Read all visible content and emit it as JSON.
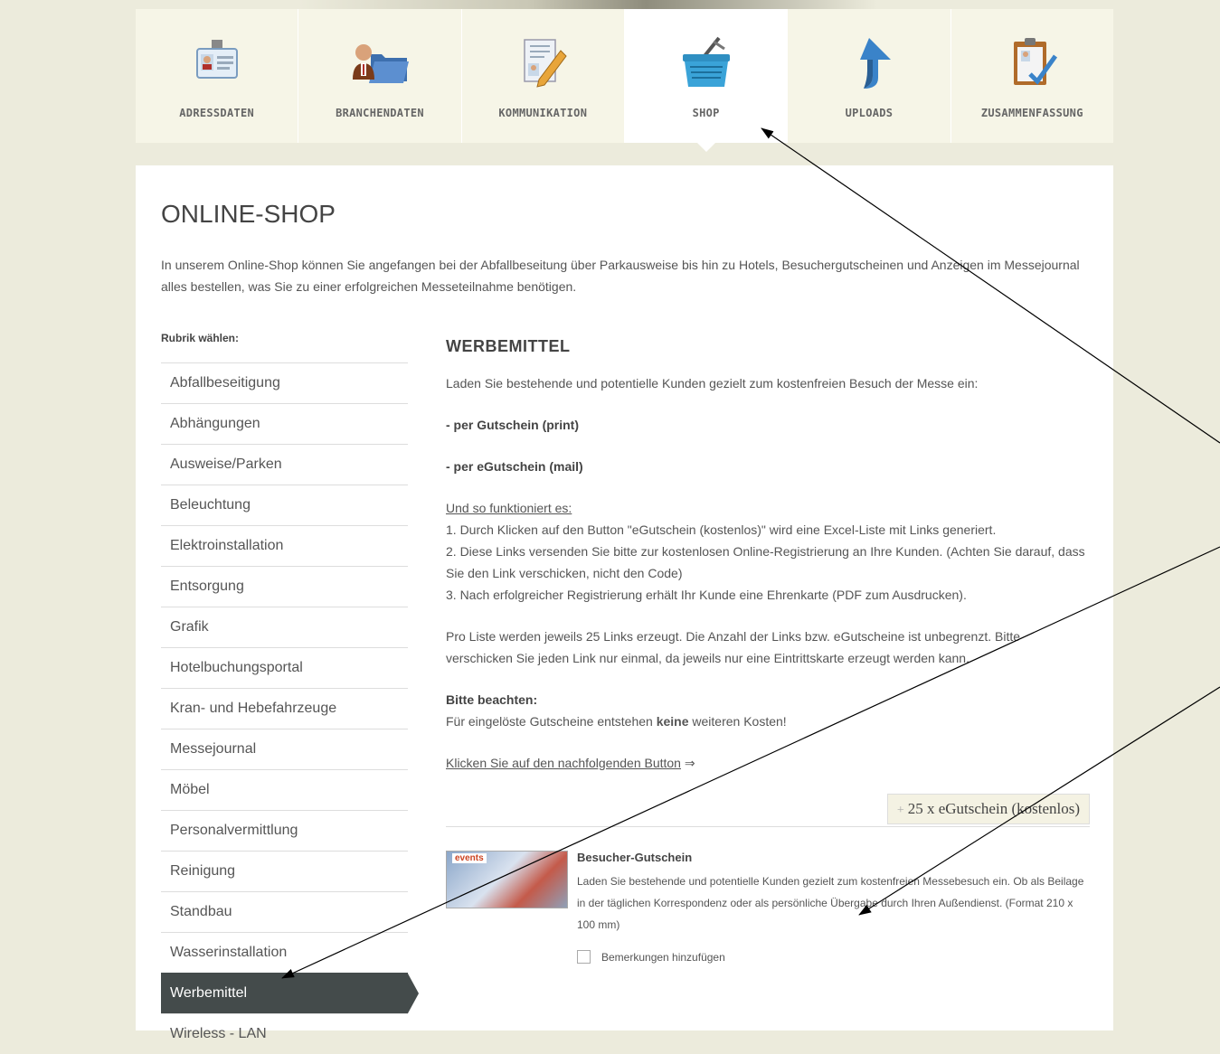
{
  "tabs": [
    {
      "label": "ADRESSDATEN",
      "icon": "id-badge-icon"
    },
    {
      "label": "BRANCHENDATEN",
      "icon": "folder-user-icon"
    },
    {
      "label": "KOMMUNIKATION",
      "icon": "document-pencil-icon"
    },
    {
      "label": "SHOP",
      "icon": "shopping-basket-icon",
      "active": true
    },
    {
      "label": "UPLOADS",
      "icon": "upload-arrow-icon"
    },
    {
      "label": "ZUSAMMENFASSUNG",
      "icon": "clipboard-check-icon"
    }
  ],
  "page": {
    "title": "ONLINE-SHOP",
    "intro": "In unserem Online-Shop können Sie angefangen bei der Abfallbeseitung über Parkausweise bis hin zu Hotels, Besuchergutscheinen und Anzeigen im Messejournal alles bestellen, was Sie zu einer erfolgreichen Messeteilnahme benötigen."
  },
  "sidebar": {
    "label": "Rubrik wählen:",
    "items": [
      {
        "label": "Abfallbeseitigung"
      },
      {
        "label": "Abhängungen"
      },
      {
        "label": "Ausweise/Parken"
      },
      {
        "label": "Beleuchtung"
      },
      {
        "label": "Elektroinstallation"
      },
      {
        "label": "Entsorgung"
      },
      {
        "label": "Grafik"
      },
      {
        "label": "Hotelbuchungsportal"
      },
      {
        "label": "Kran- und Hebefahrzeuge"
      },
      {
        "label": "Messejournal"
      },
      {
        "label": "Möbel"
      },
      {
        "label": "Personalvermittlung"
      },
      {
        "label": "Reinigung"
      },
      {
        "label": "Standbau"
      },
      {
        "label": "Wasserinstallation"
      },
      {
        "label": "Werbemittel",
        "active": true
      },
      {
        "label": "Wireless - LAN"
      }
    ]
  },
  "main": {
    "section_title": "WERBEMITTEL",
    "lead": "Laden Sie bestehende und potentielle Kunden gezielt zum kostenfreien Besuch der Messe ein:",
    "option1": "- per Gutschein (print)",
    "option2": "- per eGutschein (mail)",
    "howto_heading": "Und so funktioniert es:",
    "step1": "1. Durch Klicken auf den Button \"eGutschein (kostenlos)\" wird eine Excel-Liste mit Links generiert.",
    "step2": "2. Diese Links versenden Sie bitte zur kostenlosen Online-Registrierung an Ihre Kunden. (Achten Sie darauf, dass Sie den Link verschicken, nicht den Code)",
    "step3": "3. Nach erfolgreicher Registrierung erhält Ihr Kunde eine Ehrenkarte (PDF zum Ausdrucken).",
    "list_info": "Pro Liste werden jeweils 25 Links erzeugt. Die Anzahl der Links bzw. eGutscheine ist unbegrenzt. Bitte verschicken Sie jeden Link nur einmal, da jeweils nur eine Eintrittskarte erzeugt werden kann.",
    "note_heading": "Bitte beachten:",
    "note_pre": "Für eingelöste Gutscheine entstehen ",
    "note_bold": "keine",
    "note_post": " weiteren Kosten!",
    "click_hint": "Klicken Sie auf den nachfolgenden Button",
    "click_arrow": " ⇒",
    "button_plus": "+",
    "button_label": "25 x eGutschein (kostenlos)"
  },
  "product": {
    "image_text": "events",
    "title": "Besucher-Gutschein",
    "description": "Laden Sie bestehende und potentielle Kunden gezielt zum kostenfreien Messebesuch ein. Ob als Beilage in der täglichen Korrespondenz oder als persönliche Übergabe durch Ihren Außendienst. (Format 210 x 100 mm)",
    "remarks_label": "Bemerkungen hinzufügen"
  },
  "colors": {
    "background": "#ecebdc",
    "tab_bg": "#f6f5e7",
    "sidebar_active": "#444b4b"
  }
}
